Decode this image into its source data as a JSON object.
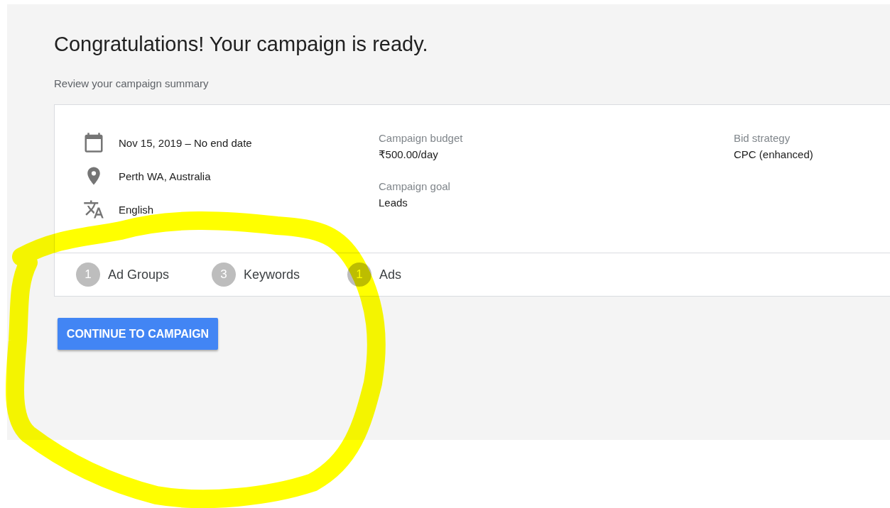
{
  "title": "Congratulations! Your campaign is ready.",
  "subtitle": "Review your campaign summary",
  "summary": {
    "details": [
      {
        "kind": "date",
        "text": "Nov 15, 2019 – No end date"
      },
      {
        "kind": "location",
        "text": "Perth WA, Australia"
      },
      {
        "kind": "language",
        "text": "English"
      }
    ],
    "fields": [
      {
        "label": "Campaign budget",
        "value": "₹500.00/day"
      },
      {
        "label": "Campaign goal",
        "value": "Leads"
      },
      {
        "label": "Bid strategy",
        "value": "CPC (enhanced)"
      }
    ],
    "counts": [
      {
        "count": "1",
        "label": "Ad Groups"
      },
      {
        "count": "3",
        "label": "Keywords"
      },
      {
        "count": "1",
        "label": "Ads"
      }
    ]
  },
  "button": "CONTINUE TO CAMPAIGN",
  "annotation": {
    "kind": "circle"
  }
}
